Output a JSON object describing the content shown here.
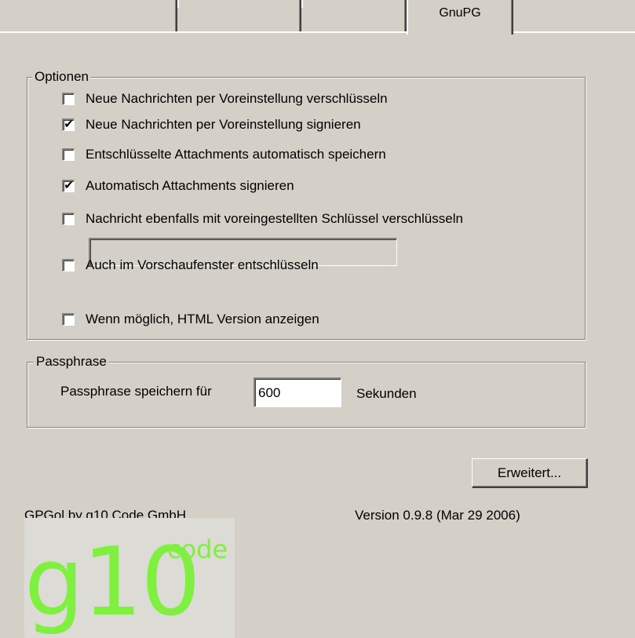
{
  "tabs": [
    "",
    "",
    "",
    "GnuPG",
    ""
  ],
  "optionen": {
    "legend": "Optionen",
    "items": [
      {
        "label": "Neue Nachrichten per Voreinstellung verschlüsseln",
        "checked": false
      },
      {
        "label": "Neue Nachrichten per Voreinstellung signieren",
        "checked": true
      },
      {
        "label": "Entschlüsselte Attachments automatisch speichern",
        "checked": false
      },
      {
        "label": "Automatisch Attachments signieren",
        "checked": true
      },
      {
        "label": "Nachricht ebenfalls mit voreingestellten Schlüssel verschlüsseln",
        "checked": false
      },
      {
        "label": "Auch im Vorschaufenster entschlüsseln",
        "checked": false
      },
      {
        "label": "Wenn möglich, HTML Version anzeigen",
        "checked": false
      }
    ],
    "key_field_value": ""
  },
  "passphrase": {
    "legend": "Passphrase",
    "label": "Passphrase speichern für",
    "value": "600",
    "unit": "Sekunden"
  },
  "erweitert_label": "Erweitert...",
  "footer": {
    "credit": "GPGol by g10 Code GmbH",
    "version": "Version 0.9.8 (Mar 29 2006)"
  },
  "logo": {
    "main": "g10",
    "sup": "code",
    "color": "#80f040"
  },
  "check_glyph": "✔"
}
